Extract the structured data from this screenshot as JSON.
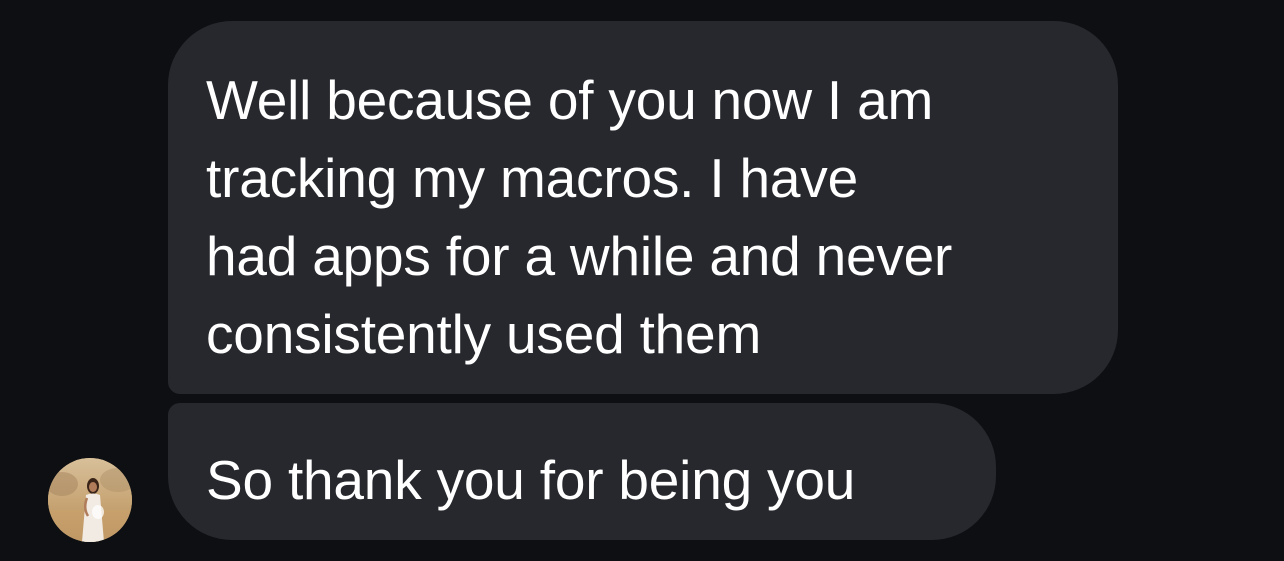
{
  "conversation": {
    "messages": [
      {
        "sender": "other",
        "text": "Well because of you now I am\ntracking my macros. I have\nhad apps for a while and never\nconsistently used them"
      },
      {
        "sender": "other",
        "text": "So thank you for being you"
      }
    ],
    "avatar": {
      "icon": "person-photo-avatar"
    }
  },
  "colors": {
    "background": "#0d0f13",
    "bubble": "#26282d",
    "text": "#ffffff"
  }
}
